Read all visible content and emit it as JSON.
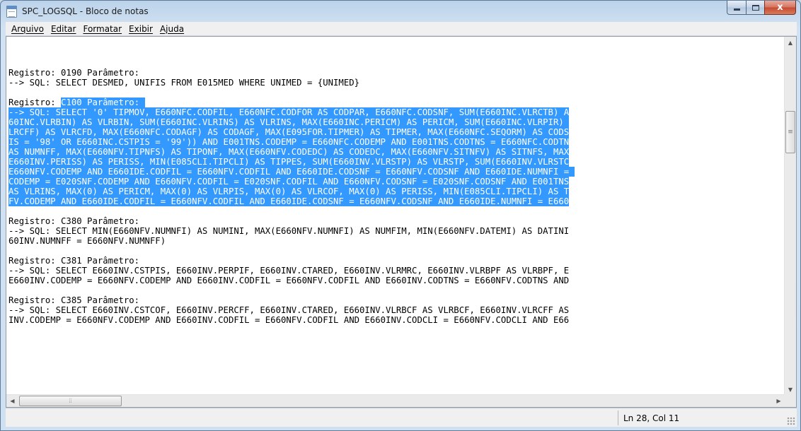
{
  "window": {
    "title": "SPC_LOGSQL - Bloco de notas",
    "icon": "notepad-icon",
    "controls": [
      "minimize-icon",
      "maximize-icon",
      "close-icon"
    ],
    "close_glyph": "x"
  },
  "menu": [
    "Arquivo",
    "Editar",
    "Formatar",
    "Exibir",
    "Ajuda"
  ],
  "editor": {
    "blocks": [
      {
        "lines": [
          {
            "text": "Registro: 0190 Parâmetro:"
          },
          {
            "text": "--> SQL: SELECT DESMED, UNIFIS FROM E015MED WHERE UNIMED = {UNIMED}"
          }
        ]
      },
      {
        "lines": [
          {
            "pre": "Registro: ",
            "sel": "C100 Parâmetro: "
          },
          {
            "sel": "--> SQL: SELECT '0' TIPMOV, E660NFC.CODFIL, E660NFC.CODFOR AS CODPAR, E660NFC.CODSNF, SUM(E660INC.VLRCTB) A"
          },
          {
            "sel": "60INC.VLRBIN) AS VLRBIN, SUM(E660INC.VLRINS) AS VLRINS, MAX(E660INC.PERICM) AS PERICM, SUM(E660INC.VLRPIR) "
          },
          {
            "sel": "LRCFF) AS VLRCFD, MAX(E660NFC.CODAGF) AS CODAGF, MAX(E095FOR.TIPMER) AS TIPMER, MAX(E660NFC.SEQORM) AS CODS"
          },
          {
            "sel": "IS = '98' OR E660INC.CSTPIS = '99')) AND E001TNS.CODEMP = E660NFC.CODEMP AND E001TNS.CODTNS = E660NFC.CODTN"
          },
          {
            "sel": "AS NUMNFF, MAX(E660NFV.TIPNFS) AS TIPONF, MAX(E660NFV.CODEDC) AS CODEDC, MAX(E660NFV.SITNFV) AS SITNFS, MAX"
          },
          {
            "sel": "E660INV.PERISS) AS PERISS, MIN(E085CLI.TIPCLI) AS TIPPES, SUM(E660INV.VLRSTP) AS VLRSTP, SUM(E660INV.VLRSTC"
          },
          {
            "sel": "E660NFV.CODEMP AND E660IDE.CODFIL = E660NFV.CODFIL AND E660IDE.CODSNF = E660NFV.CODSNF AND E660IDE.NUMNFI = "
          },
          {
            "sel": "CODEMP = E020SNF.CODEMP AND E660NFV.CODFIL = E020SNF.CODFIL AND E660NFV.CODSNF = E020SNF.CODSNF AND E001TNS"
          },
          {
            "sel": "AS VLRINS, MAX(0) AS PERICM, MAX(0) AS VLRPIS, MAX(0) AS VLRCOF, MAX(0) AS PERISS, MIN(E085CLI.TIPCLI) AS T"
          },
          {
            "sel": "FV.CODEMP AND E660IDE.CODFIL = E660NFV.CODFIL AND E660IDE.CODSNF = E660NFV.CODSNF AND E660IDE.NUMNFI = E660"
          }
        ]
      },
      {
        "lines": [
          {
            "text": "Registro: C380 Parâmetro:"
          },
          {
            "text": "--> SQL: SELECT MIN(E660NFV.NUMNFI) AS NUMINI, MAX(E660NFV.NUMNFI) AS NUMFIM, MIN(E660NFV.DATEMI) AS DATINI"
          },
          {
            "text": "60INV.NUMNFF = E660NFV.NUMNFF)"
          }
        ]
      },
      {
        "lines": [
          {
            "text": "Registro: C381 Parâmetro:"
          },
          {
            "text": "--> SQL: SELECT E660INV.CSTPIS, E660INV.PERPIF, E660INV.CTARED, E660INV.VLRMRC, E660INV.VLRBPF AS VLRBPF, E"
          },
          {
            "text": "E660INV.CODEMP = E660NFV.CODEMP AND E660INV.CODFIL = E660NFV.CODFIL AND E660INV.CODTNS = E660NFV.CODTNS AND"
          }
        ]
      },
      {
        "lines": [
          {
            "text": "Registro: C385 Parâmetro:"
          },
          {
            "text": "--> SQL: SELECT E660INV.CSTCOF, E660INV.PERCFF, E660INV.CTARED, E660INV.VLRBCF AS VLRBCF, E660INV.VLRCFF AS"
          },
          {
            "text": "INV.CODEMP = E660NFV.CODEMP AND E660INV.CODFIL = E660NFV.CODFIL AND E660INV.CODCLI = E660NFV.CODCLI AND E66"
          }
        ]
      }
    ],
    "selection_color": "#3399ff"
  },
  "scrollbars": {
    "vertical": {
      "up_icon": "scroll-up-icon",
      "down_icon": "scroll-down-icon",
      "position": 0.2
    },
    "horizontal": {
      "left_icon": "scroll-left-icon",
      "right_icon": "scroll-right-icon",
      "position": 0.0
    }
  },
  "statusbar": {
    "position": "Ln 28, Col 11"
  }
}
